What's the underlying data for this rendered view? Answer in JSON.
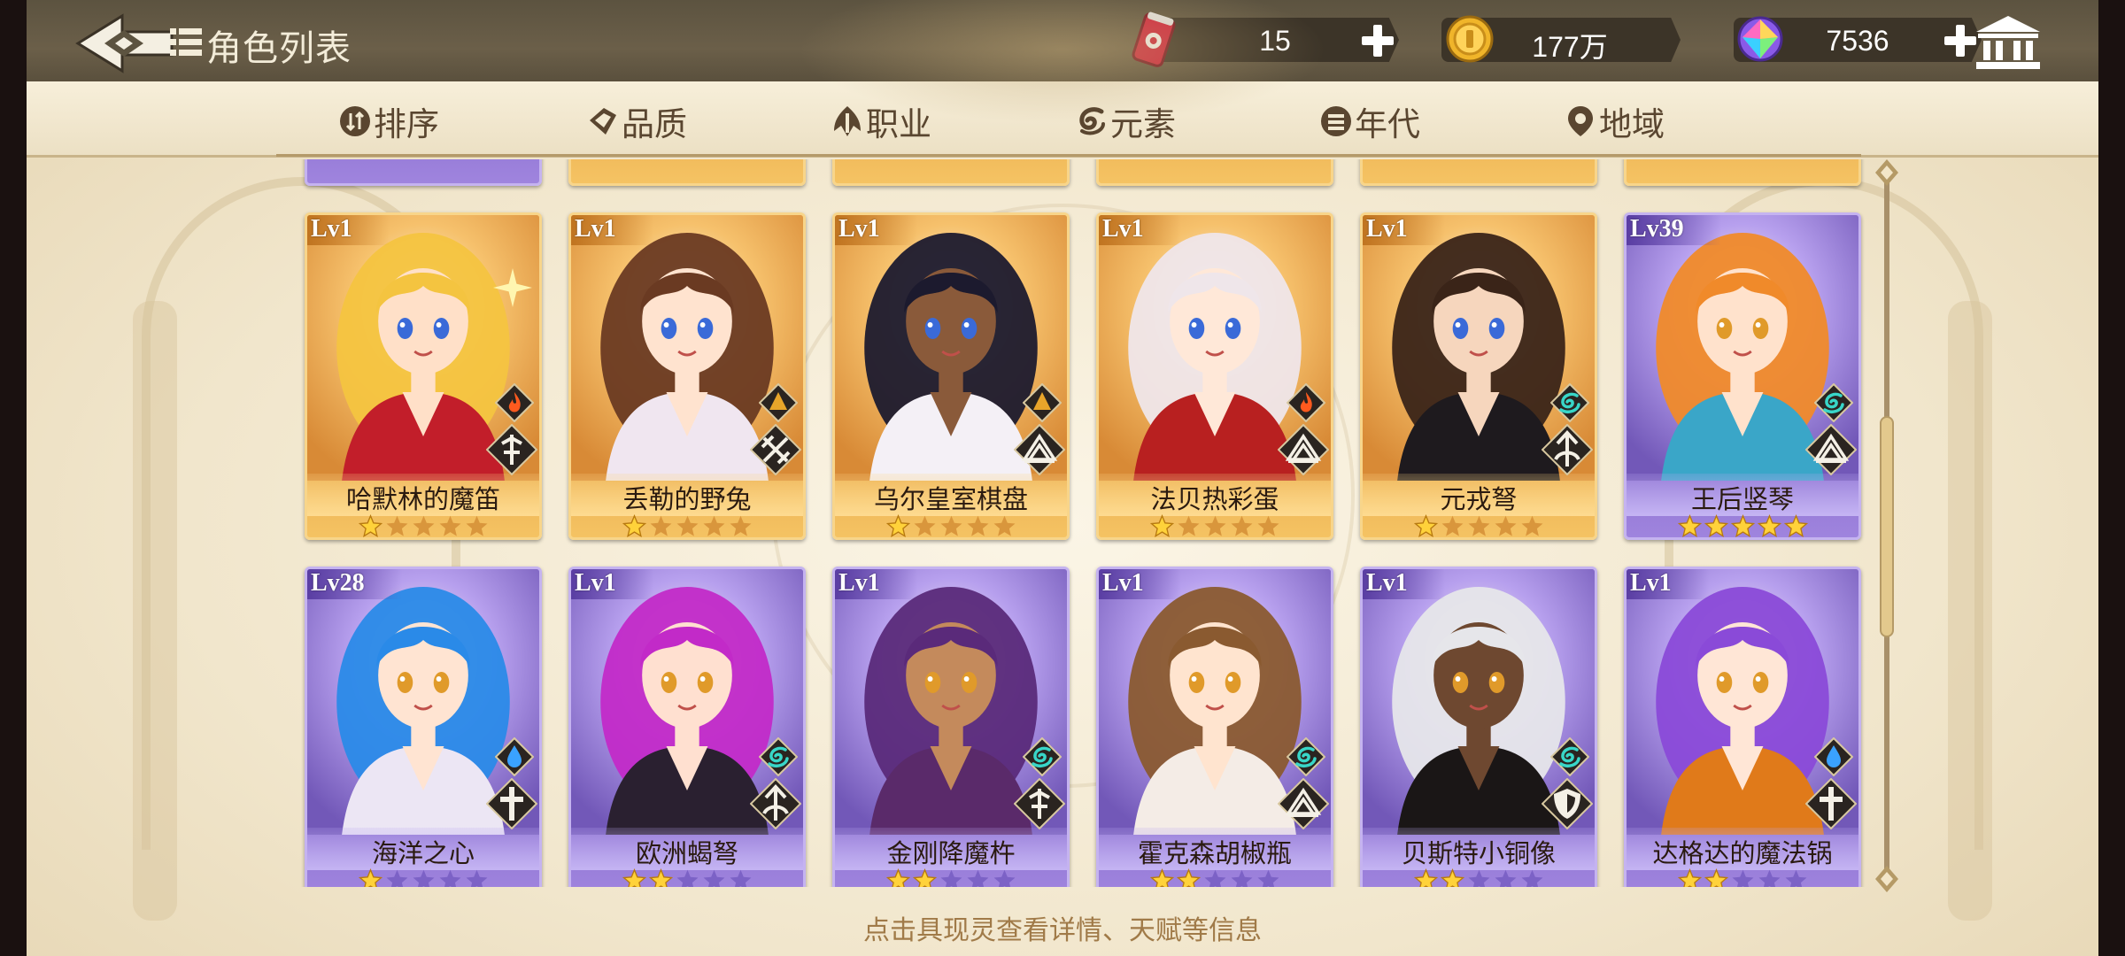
{
  "header": {
    "title": "角色列表",
    "resources": [
      {
        "name": "stamina-drink",
        "icon": "soda-can-icon",
        "value": "15",
        "has_plus": true
      },
      {
        "name": "gold",
        "icon": "gold-coin-icon",
        "value": "177万",
        "has_plus": false
      },
      {
        "name": "gems",
        "icon": "rainbow-gem-icon",
        "value": "7536",
        "has_plus": true
      }
    ]
  },
  "filters": [
    {
      "label": "排序",
      "icon": "sort-icon"
    },
    {
      "label": "品质",
      "icon": "quality-icon"
    },
    {
      "label": "职业",
      "icon": "profession-icon"
    },
    {
      "label": "元素",
      "icon": "element-icon"
    },
    {
      "label": "年代",
      "icon": "era-icon"
    },
    {
      "label": "地域",
      "icon": "location-pin-icon"
    }
  ],
  "characters": [
    {
      "level": "Lv1",
      "name": "哈默林的魔笛",
      "stars": 1,
      "rarity": "gold",
      "element": "fire",
      "class": "dagger"
    },
    {
      "level": "Lv1",
      "name": "丢勒的野兔",
      "stars": 1,
      "rarity": "gold",
      "element": "earth",
      "class": "crossed-swords"
    },
    {
      "level": "Lv1",
      "name": "乌尔皇室棋盘",
      "stars": 1,
      "rarity": "gold",
      "element": "earth",
      "class": "book"
    },
    {
      "level": "Lv1",
      "name": "法贝热彩蛋",
      "stars": 1,
      "rarity": "gold",
      "element": "fire",
      "class": "book"
    },
    {
      "level": "Lv1",
      "name": "元戎弩",
      "stars": 1,
      "rarity": "gold",
      "element": "wind",
      "class": "bow"
    },
    {
      "level": "Lv39",
      "name": "王后竖琴",
      "stars": 5,
      "rarity": "purple",
      "element": "wind",
      "class": "book"
    },
    {
      "level": "Lv28",
      "name": "海洋之心",
      "stars": 1,
      "rarity": "purple",
      "element": "water",
      "class": "cross"
    },
    {
      "level": "Lv1",
      "name": "欧洲蝎弩",
      "stars": 2,
      "rarity": "purple",
      "element": "wind",
      "class": "bow"
    },
    {
      "level": "Lv1",
      "name": "金刚降魔杵",
      "stars": 2,
      "rarity": "purple",
      "element": "wind",
      "class": "dagger"
    },
    {
      "level": "Lv1",
      "name": "霍克森胡椒瓶",
      "stars": 2,
      "rarity": "purple",
      "element": "wind",
      "class": "book"
    },
    {
      "level": "Lv1",
      "name": "贝斯特小铜像",
      "stars": 2,
      "rarity": "purple",
      "element": "wind",
      "class": "shield"
    },
    {
      "level": "Lv1",
      "name": "达格达的魔法锅",
      "stars": 2,
      "rarity": "purple",
      "element": "water",
      "class": "cross"
    }
  ],
  "hint": "点击具现灵查看详情、天赋等信息",
  "colors": {
    "gold_card": "#e09a3e",
    "purple_card": "#7e62c4",
    "star_on": "#ffd23a",
    "fire": "#ff5a1e",
    "earth": "#e8a52a",
    "wind": "#38d6c8",
    "water": "#3aa2ff"
  }
}
